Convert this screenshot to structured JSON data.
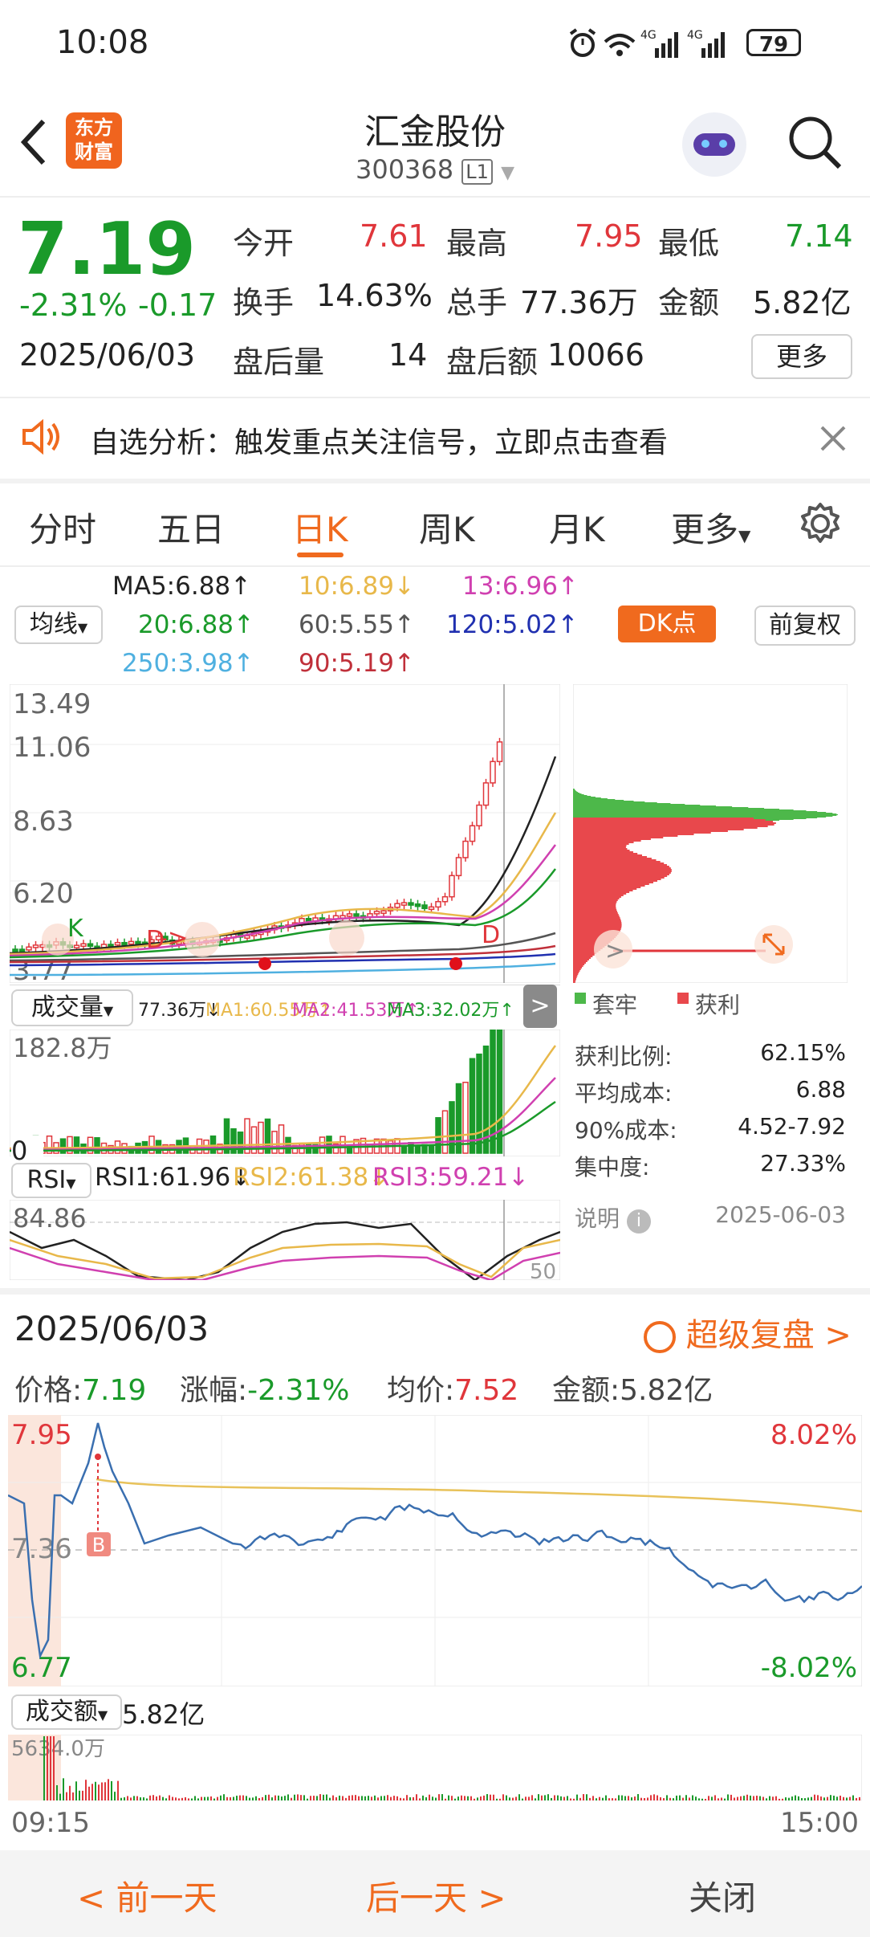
{
  "status": {
    "time": "10:08",
    "battery": "79",
    "net1": "4G",
    "net2": "4G"
  },
  "header": {
    "logo_line1": "东方",
    "logo_line2": "财富",
    "title": "汇金股份",
    "code": "300368",
    "level": "L1"
  },
  "quote": {
    "price": "7.19",
    "change_pct": "-2.31%",
    "change": "-0.17",
    "date": "2025/06/03",
    "open_label": "今开",
    "open": "7.61",
    "high_label": "最高",
    "high": "7.95",
    "low_label": "最低",
    "low": "7.14",
    "turnover_label": "换手",
    "turnover": "14.63%",
    "volume_label": "总手",
    "volume": "77.36万",
    "amount_label": "金额",
    "amount": "5.82亿",
    "after_vol_label": "盘后量",
    "after_vol": "14",
    "after_amt_label": "盘后额",
    "after_amt": "10066",
    "more_btn": "更多"
  },
  "banner": {
    "text": "自选分析：触发重点关注信号，立即点击查看"
  },
  "tabs": [
    "分时",
    "五日",
    "日K",
    "周K",
    "月K",
    "更多"
  ],
  "ma": {
    "selector": "均线",
    "ma5": "MA5:6.88",
    "ma10": "10:6.89",
    "ma13": "13:6.96",
    "ma20": "20:6.88",
    "ma60": "60:5.55",
    "ma120": "120:5.02",
    "ma250": "250:3.98",
    "ma90": "90:5.19",
    "dk_btn": "DK点",
    "fq_btn": "前复权",
    "colors": {
      "ma5": "#222222",
      "ma10": "#e8b84a",
      "ma13": "#d040b0",
      "ma20": "#1a9a2a",
      "ma60": "#555555",
      "ma120": "#2030b0",
      "ma250": "#4fb0e0",
      "ma90": "#c0303a"
    }
  },
  "kline": {
    "y_labels": [
      "13.49",
      "11.06",
      "8.63",
      "6.20",
      "3.77"
    ],
    "markers": [
      "K",
      "D",
      "D"
    ]
  },
  "volume": {
    "selector": "成交量",
    "vol": "77.36万",
    "ma1": "MA1:60.55万",
    "ma2": "MA2:41.53万",
    "ma3": "MA3:32.02万",
    "max_label": "182.8万",
    "zero": "0"
  },
  "rsi": {
    "selector": "RSI",
    "rsi1": "RSI1:61.96",
    "rsi2": "RSI2:61.38",
    "rsi3": "RSI3:59.21",
    "top": "84.86",
    "bottom": "50"
  },
  "chip": {
    "legend_locked": "套牢",
    "legend_profit": "获利",
    "rows": [
      {
        "label": "获利比例:",
        "value": "62.15%"
      },
      {
        "label": "平均成本:",
        "value": "6.88"
      },
      {
        "label": "90%成本:",
        "value": "4.52-7.92"
      },
      {
        "label": "集中度:",
        "value": "27.33%"
      }
    ],
    "note": "说明",
    "date": "2025-06-03"
  },
  "intraday": {
    "date": "2025/06/03",
    "replay": "超级复盘",
    "price_label": "价格:",
    "price": "7.19",
    "chg_label": "涨幅:",
    "chg": "-2.31%",
    "avg_label": "均价:",
    "avg": "7.52",
    "amt_label": "金额:",
    "amt": "5.82亿",
    "y_top": "7.95",
    "y_mid": "7.36",
    "y_bot": "6.77",
    "pct_top": "8.02%",
    "pct_bot": "-8.02%",
    "buy_marker": "B",
    "vol_selector": "成交额",
    "vol_total": "5.82亿",
    "vol_max": "5634.0万",
    "t_start": "09:15",
    "t_end": "15:00"
  },
  "bottom": {
    "prev": "前一天",
    "next": "后一天",
    "close": "关闭"
  }
}
